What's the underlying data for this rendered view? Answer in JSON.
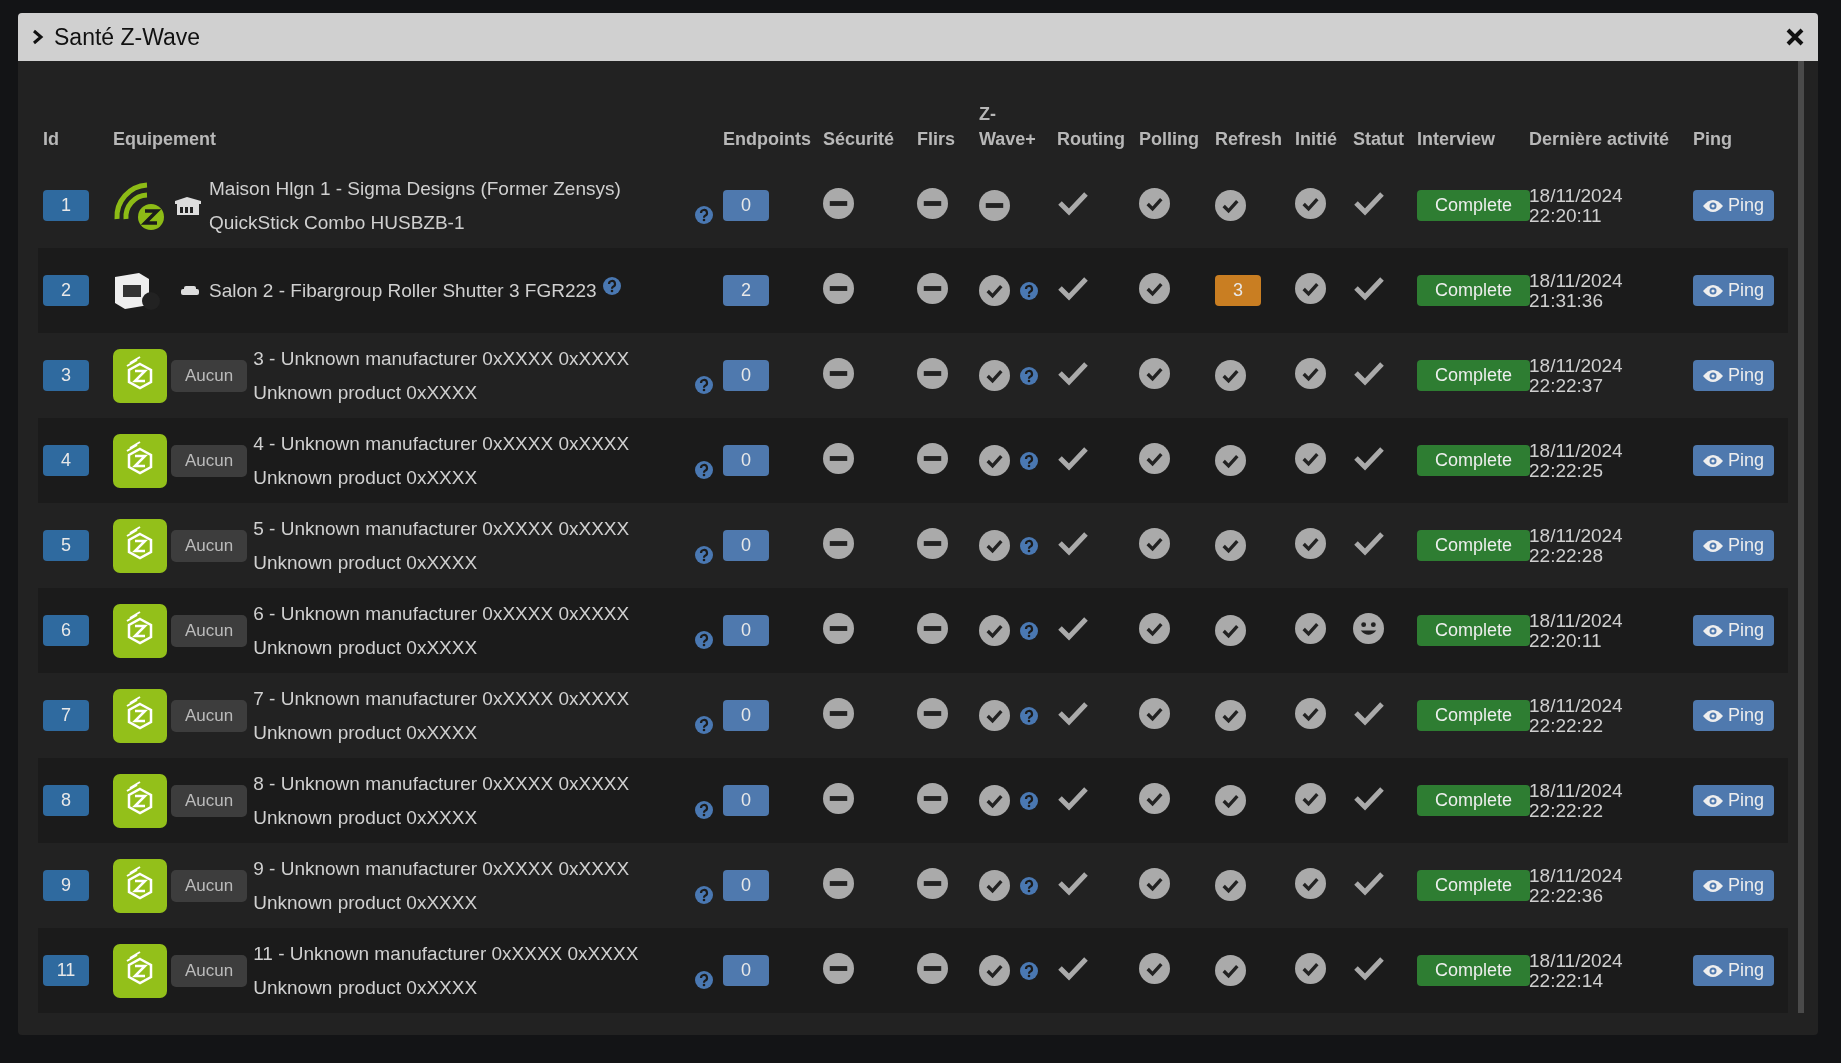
{
  "window": {
    "title": "Santé Z-Wave"
  },
  "table": {
    "columns": [
      "Id",
      "Equipement",
      "Endpoints",
      "Sécurité",
      "Flirs",
      "Z-Wave+",
      "Routing",
      "Polling",
      "Refresh",
      "Initié",
      "Statut",
      "Interview",
      "Dernière activité",
      "Ping"
    ],
    "rows": [
      {
        "id": "1",
        "device": {
          "kind": "controller",
          "room": {
            "kind": "house"
          },
          "name": "Maison Hlgn 1 - Sigma Designs (Former Zensys) QuickStick Combo HUSBZB-1",
          "help": true
        },
        "endpoints": "0",
        "securite": false,
        "flirs": false,
        "zwave_plus": {
          "on": false,
          "help": false
        },
        "routing": true,
        "polling": true,
        "refresh": {
          "kind": "check"
        },
        "initie": true,
        "statut": {
          "kind": "check"
        },
        "interview": "Complete",
        "date": "18/11/2024",
        "time": "22:20:11",
        "ping": "Ping"
      },
      {
        "id": "2",
        "device": {
          "kind": "product",
          "room": {
            "kind": "sofa"
          },
          "name": "Salon 2 - Fibargroup Roller Shutter 3 FGR223",
          "help": true
        },
        "endpoints": "2",
        "securite": false,
        "flirs": false,
        "zwave_plus": {
          "on": true,
          "help": true
        },
        "routing": true,
        "polling": true,
        "refresh": {
          "kind": "count",
          "value": "3"
        },
        "initie": true,
        "statut": {
          "kind": "check"
        },
        "interview": "Complete",
        "date": "18/11/2024",
        "time": "21:31:36",
        "ping": "Ping"
      },
      {
        "id": "3",
        "device": {
          "kind": "module",
          "room": {
            "kind": "badge",
            "label": "Aucun"
          },
          "name": "3 - Unknown manufacturer 0xXXXX 0xXXXX Unknown product 0xXXXX",
          "help": true
        },
        "endpoints": "0",
        "securite": false,
        "flirs": false,
        "zwave_plus": {
          "on": true,
          "help": true
        },
        "routing": true,
        "polling": true,
        "refresh": {
          "kind": "check"
        },
        "initie": true,
        "statut": {
          "kind": "check"
        },
        "interview": "Complete",
        "date": "18/11/2024",
        "time": "22:22:37",
        "ping": "Ping"
      },
      {
        "id": "4",
        "device": {
          "kind": "module",
          "room": {
            "kind": "badge",
            "label": "Aucun"
          },
          "name": "4 - Unknown manufacturer 0xXXXX 0xXXXX Unknown product 0xXXXX",
          "help": true
        },
        "endpoints": "0",
        "securite": false,
        "flirs": false,
        "zwave_plus": {
          "on": true,
          "help": true
        },
        "routing": true,
        "polling": true,
        "refresh": {
          "kind": "check"
        },
        "initie": true,
        "statut": {
          "kind": "check"
        },
        "interview": "Complete",
        "date": "18/11/2024",
        "time": "22:22:25",
        "ping": "Ping"
      },
      {
        "id": "5",
        "device": {
          "kind": "module",
          "room": {
            "kind": "badge",
            "label": "Aucun"
          },
          "name": "5 - Unknown manufacturer 0xXXXX 0xXXXX Unknown product 0xXXXX",
          "help": true
        },
        "endpoints": "0",
        "securite": false,
        "flirs": false,
        "zwave_plus": {
          "on": true,
          "help": true
        },
        "routing": true,
        "polling": true,
        "refresh": {
          "kind": "check"
        },
        "initie": true,
        "statut": {
          "kind": "check"
        },
        "interview": "Complete",
        "date": "18/11/2024",
        "time": "22:22:28",
        "ping": "Ping"
      },
      {
        "id": "6",
        "device": {
          "kind": "module",
          "room": {
            "kind": "badge",
            "label": "Aucun"
          },
          "name": "6 - Unknown manufacturer 0xXXXX 0xXXXX Unknown product 0xXXXX",
          "help": true
        },
        "endpoints": "0",
        "securite": false,
        "flirs": false,
        "zwave_plus": {
          "on": true,
          "help": true
        },
        "routing": true,
        "polling": true,
        "refresh": {
          "kind": "check"
        },
        "initie": true,
        "statut": {
          "kind": "smiley"
        },
        "interview": "Complete",
        "date": "18/11/2024",
        "time": "22:20:11",
        "ping": "Ping"
      },
      {
        "id": "7",
        "device": {
          "kind": "module",
          "room": {
            "kind": "badge",
            "label": "Aucun"
          },
          "name": "7 - Unknown manufacturer 0xXXXX 0xXXXX Unknown product 0xXXXX",
          "help": true
        },
        "endpoints": "0",
        "securite": false,
        "flirs": false,
        "zwave_plus": {
          "on": true,
          "help": true
        },
        "routing": true,
        "polling": true,
        "refresh": {
          "kind": "check"
        },
        "initie": true,
        "statut": {
          "kind": "check"
        },
        "interview": "Complete",
        "date": "18/11/2024",
        "time": "22:22:22",
        "ping": "Ping"
      },
      {
        "id": "8",
        "device": {
          "kind": "module",
          "room": {
            "kind": "badge",
            "label": "Aucun"
          },
          "name": "8 - Unknown manufacturer 0xXXXX 0xXXXX Unknown product 0xXXXX",
          "help": true
        },
        "endpoints": "0",
        "securite": false,
        "flirs": false,
        "zwave_plus": {
          "on": true,
          "help": true
        },
        "routing": true,
        "polling": true,
        "refresh": {
          "kind": "check"
        },
        "initie": true,
        "statut": {
          "kind": "check"
        },
        "interview": "Complete",
        "date": "18/11/2024",
        "time": "22:22:22",
        "ping": "Ping"
      },
      {
        "id": "9",
        "device": {
          "kind": "module",
          "room": {
            "kind": "badge",
            "label": "Aucun"
          },
          "name": "9 - Unknown manufacturer 0xXXXX 0xXXXX Unknown product 0xXXXX",
          "help": true
        },
        "endpoints": "0",
        "securite": false,
        "flirs": false,
        "zwave_plus": {
          "on": true,
          "help": true
        },
        "routing": true,
        "polling": true,
        "refresh": {
          "kind": "check"
        },
        "initie": true,
        "statut": {
          "kind": "check"
        },
        "interview": "Complete",
        "date": "18/11/2024",
        "time": "22:22:36",
        "ping": "Ping"
      },
      {
        "id": "11",
        "device": {
          "kind": "module",
          "room": {
            "kind": "badge",
            "label": "Aucun"
          },
          "name": "11 - Unknown manufacturer 0xXXXX 0xXXXX Unknown product 0xXXXX",
          "help": true
        },
        "endpoints": "0",
        "securite": false,
        "flirs": false,
        "zwave_plus": {
          "on": true,
          "help": true
        },
        "routing": true,
        "polling": true,
        "refresh": {
          "kind": "check"
        },
        "initie": true,
        "statut": {
          "kind": "check"
        },
        "interview": "Complete",
        "date": "18/11/2024",
        "time": "22:22:14",
        "ping": "Ping"
      }
    ]
  }
}
